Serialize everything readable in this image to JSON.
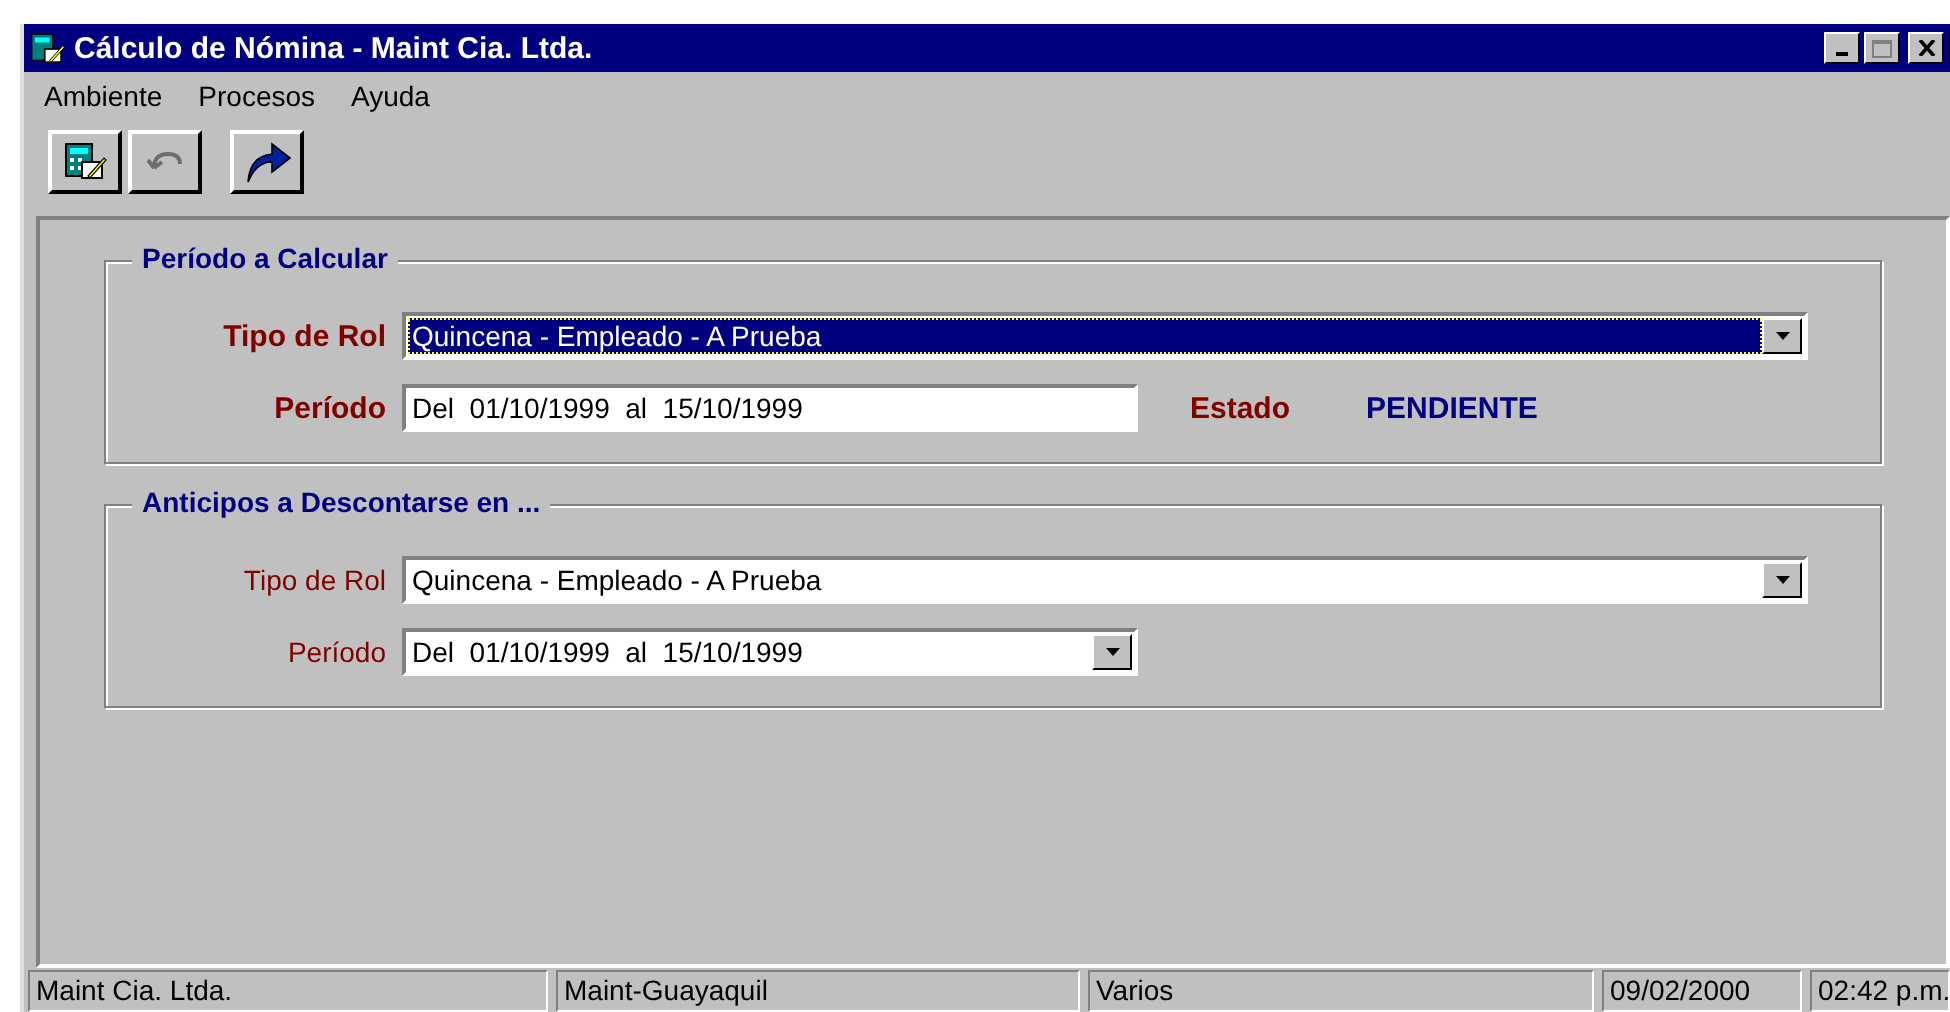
{
  "window": {
    "title": "Cálculo de Nómina - Maint Cia. Ltda."
  },
  "menu": [
    "Ambiente",
    "Procesos",
    "Ayuda"
  ],
  "toolbar": [
    {
      "kind": "calculator",
      "disabled": false
    },
    {
      "kind": "undo",
      "disabled": true
    },
    {
      "kind": "redo",
      "disabled": false
    }
  ],
  "groups": [
    {
      "title": "Período a Calcular",
      "bold_labels": true,
      "fields": [
        {
          "label": "Tipo de Rol",
          "kind": "dropdown",
          "value": "Quincena - Empleado - A Prueba",
          "selected": true
        },
        {
          "label": "Período",
          "kind": "text",
          "value": "Del  01/10/1999  al  15/10/1999",
          "selected": false,
          "status_label": "Estado",
          "status_value": "PENDIENTE"
        }
      ]
    },
    {
      "title": "Anticipos a Descontarse en ...",
      "bold_labels": false,
      "fields": [
        {
          "label": "Tipo de Rol",
          "kind": "dropdown",
          "value": "Quincena - Empleado - A Prueba",
          "selected": false
        },
        {
          "label": "Período",
          "kind": "dropdown",
          "value": "Del  01/10/1999  al  15/10/1999",
          "selected": false
        }
      ]
    }
  ],
  "status_bar": [
    "Maint Cia. Ltda.",
    "Maint-Guayaquil",
    "Varios",
    "09/02/2000",
    "02:42 p.m."
  ]
}
